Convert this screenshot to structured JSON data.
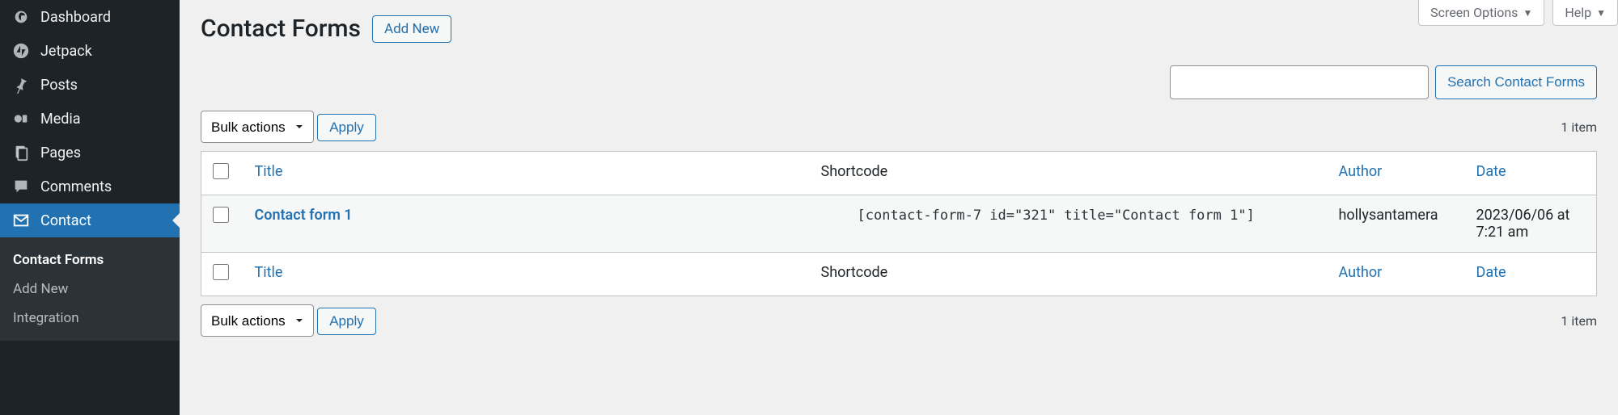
{
  "topTabs": {
    "screenOptions": "Screen Options",
    "help": "Help"
  },
  "sidebar": {
    "items": [
      {
        "label": "Dashboard"
      },
      {
        "label": "Jetpack"
      },
      {
        "label": "Posts"
      },
      {
        "label": "Media"
      },
      {
        "label": "Pages"
      },
      {
        "label": "Comments"
      },
      {
        "label": "Contact"
      }
    ],
    "submenu": [
      {
        "label": "Contact Forms"
      },
      {
        "label": "Add New"
      },
      {
        "label": "Integration"
      }
    ]
  },
  "page": {
    "title": "Contact Forms",
    "addNew": "Add New"
  },
  "search": {
    "button": "Search Contact Forms"
  },
  "bulk": {
    "label": "Bulk actions",
    "apply": "Apply"
  },
  "count": "1 item",
  "table": {
    "headers": {
      "title": "Title",
      "shortcode": "Shortcode",
      "author": "Author",
      "date": "Date"
    },
    "rows": [
      {
        "title": "Contact form 1",
        "shortcode": "[contact-form-7 id=\"321\" title=\"Contact form 1\"]",
        "author": "hollysantamera",
        "date": "2023/06/06 at 7:21 am"
      }
    ]
  }
}
